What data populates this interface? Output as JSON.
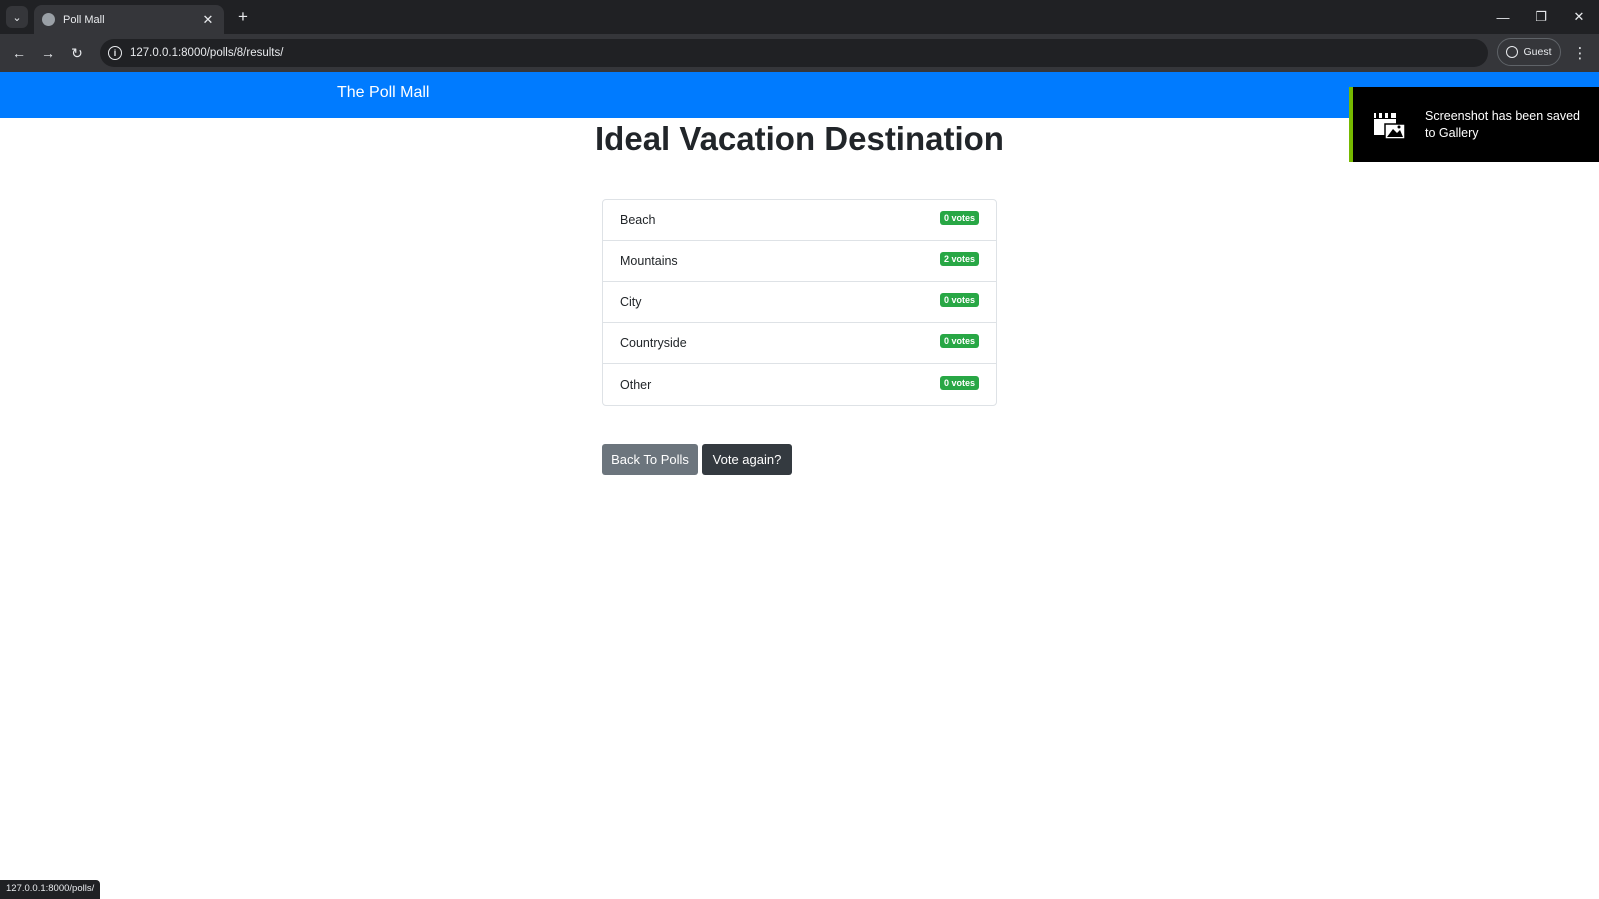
{
  "browser": {
    "tab_title": "Poll Mall",
    "url": "127.0.0.1:8000/polls/8/results/",
    "profile_label": "Guest",
    "status_url": "127.0.0.1:8000/polls/"
  },
  "navbar": {
    "brand": "The Poll Mall"
  },
  "poll": {
    "title": "Ideal Vacation Destination",
    "choices": [
      {
        "label": "Beach",
        "votes": "0 votes"
      },
      {
        "label": "Mountains",
        "votes": "2 votes"
      },
      {
        "label": "City",
        "votes": "0 votes"
      },
      {
        "label": "Countryside",
        "votes": "0 votes"
      },
      {
        "label": "Other",
        "votes": "0 votes"
      }
    ]
  },
  "actions": {
    "back_label": "Back To Polls",
    "vote_again_label": "Vote again?"
  },
  "toast": {
    "message": "Screenshot has been saved to Gallery"
  },
  "colors": {
    "navbar": "#007bff",
    "badge": "#28a745",
    "back_button": "#6c757d",
    "vote_button": "#343a40",
    "toast_accent": "#76b900"
  }
}
